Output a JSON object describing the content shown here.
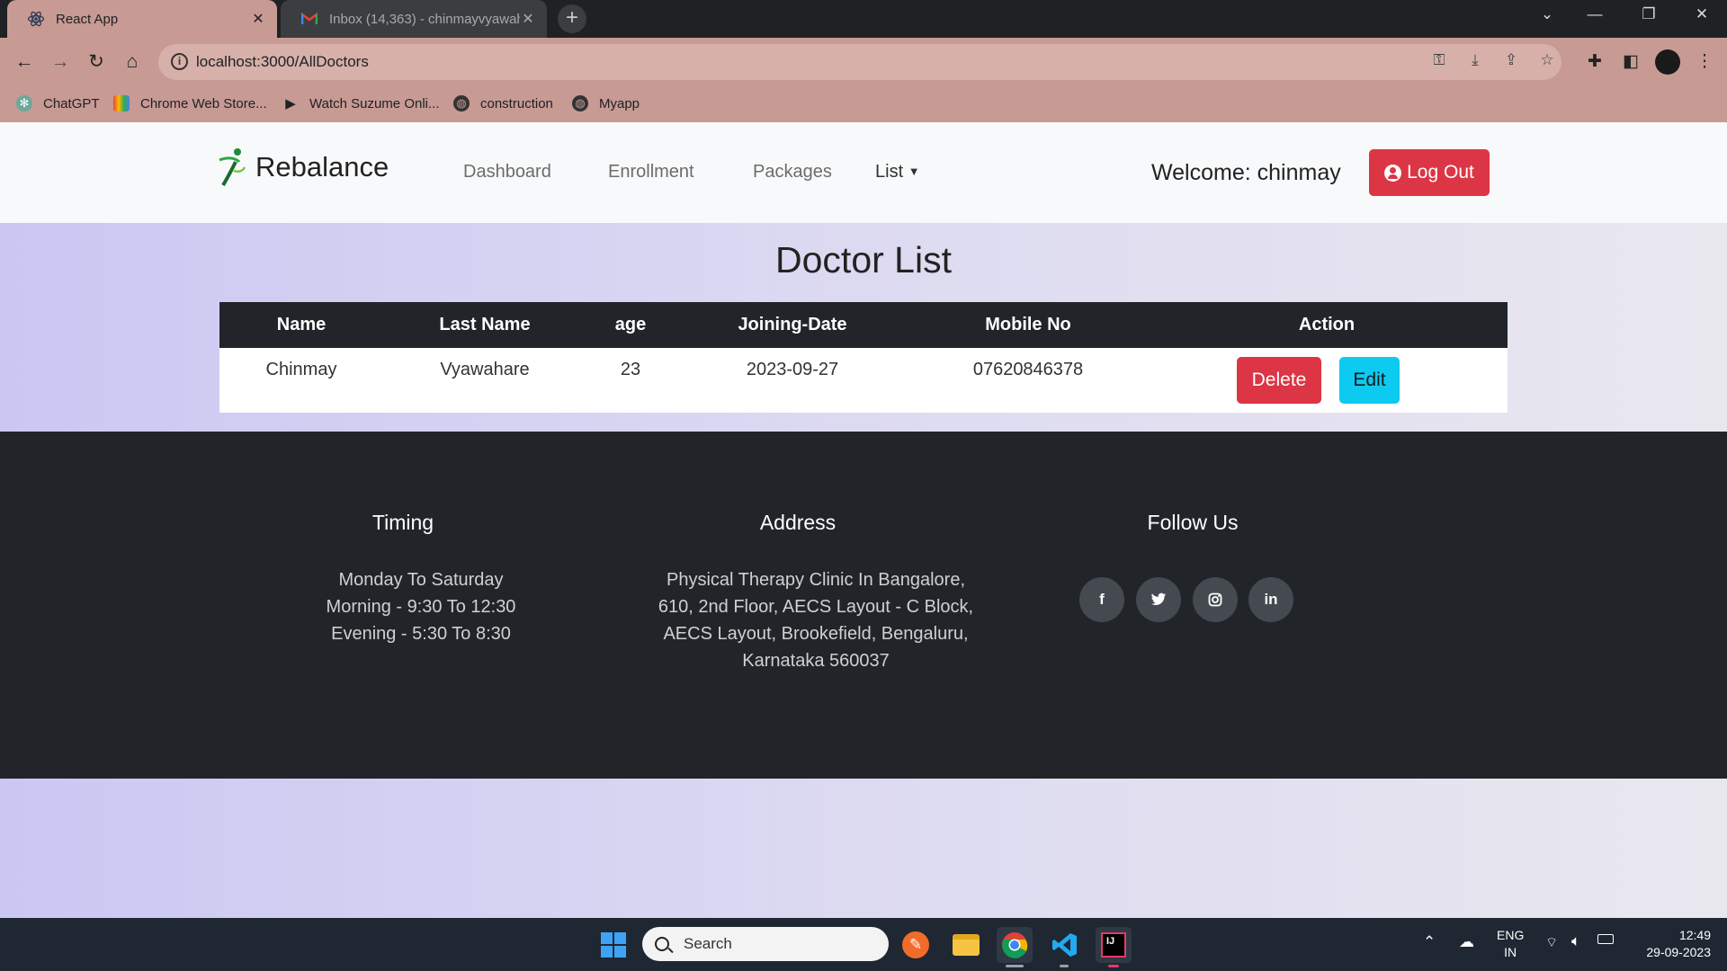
{
  "browser": {
    "tabs": [
      {
        "title": "React App",
        "icon": "react-icon",
        "active": true
      },
      {
        "title": "Inbox (14,363) - chinmayvyawah",
        "icon": "gmail-icon",
        "active": false
      }
    ],
    "url": "localhost:3000/AllDoctors",
    "bookmarks": [
      {
        "label": "ChatGPT",
        "icon": "chatgpt-icon"
      },
      {
        "label": "Chrome Web Store...",
        "icon": "webstore-icon"
      },
      {
        "label": "Watch Suzume Onli...",
        "icon": "play-icon"
      },
      {
        "label": "construction",
        "icon": "globe-icon"
      },
      {
        "label": "Myapp",
        "icon": "globe-icon"
      }
    ]
  },
  "nav": {
    "brand": "Rebalance",
    "links": [
      "Dashboard",
      "Enrollment",
      "Packages",
      "List"
    ],
    "welcome": "Welcome: chinmay",
    "logout": "Log Out"
  },
  "doctors": {
    "title": "Doctor List",
    "columns": [
      "Name",
      "Last Name",
      "age",
      "Joining-Date",
      "Mobile No",
      "Action"
    ],
    "rows": [
      {
        "name": "Chinmay",
        "last_name": "Vyawahare",
        "age": "23",
        "joining_date": "2023-09-27",
        "mobile": "07620846378"
      }
    ],
    "actions": {
      "delete": "Delete",
      "edit": "Edit"
    }
  },
  "footer": {
    "timing": {
      "heading": "Timing",
      "lines": [
        "Monday To Saturday",
        "Morning - 9:30 To 12:30",
        "Evening - 5:30 To 8:30"
      ]
    },
    "address": {
      "heading": "Address",
      "lines": [
        "Physical Therapy Clinic In Bangalore,",
        "610, 2nd Floor, AECS Layout - C Block,",
        "AECS Layout, Brookefield, Bengaluru,",
        "Karnataka 560037"
      ]
    },
    "follow": {
      "heading": "Follow Us",
      "icons": [
        "facebook-icon",
        "twitter-icon",
        "instagram-icon",
        "linkedin-icon"
      ]
    }
  },
  "taskbar": {
    "search_placeholder": "Search",
    "lang": "ENG",
    "region": "IN",
    "time": "12:49",
    "date": "29-09-2023"
  },
  "colors": {
    "danger": "#dc3545",
    "info": "#0dcaf0",
    "dark": "#212529",
    "chrome_accent": "#c79a94"
  }
}
